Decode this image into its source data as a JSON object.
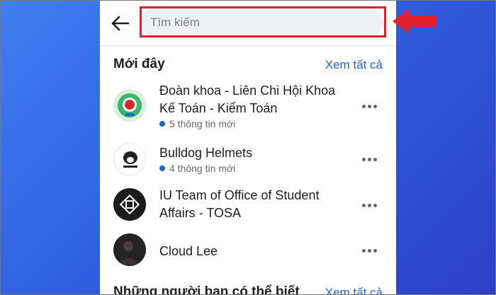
{
  "search": {
    "placeholder": "Tìm kiếm"
  },
  "recent": {
    "title": "Mới đây",
    "see_all": "Xem tất cả",
    "items": [
      {
        "name": "Đoàn khoa - Liên Chi Hội Khoa Kế Toán - Kiểm Toán",
        "meta": "5 thông tin mới"
      },
      {
        "name": "Bulldog Helmets",
        "meta": "4 thông tin mới"
      },
      {
        "name": "IU Team of Office of Student Affairs - TOSA",
        "meta": ""
      },
      {
        "name": "Cloud Lee",
        "meta": ""
      }
    ]
  },
  "suggestions": {
    "title": "Những người bạn có thể biết",
    "see_all": "Xem tất cả"
  },
  "colors": {
    "accent": "#1a66d6",
    "highlight": "#e0202a",
    "arrow": "#e0202a"
  },
  "icons": {
    "back": "arrow-left-icon",
    "more": "more-horizontal-icon",
    "annotation": "red-arrow-icon"
  }
}
